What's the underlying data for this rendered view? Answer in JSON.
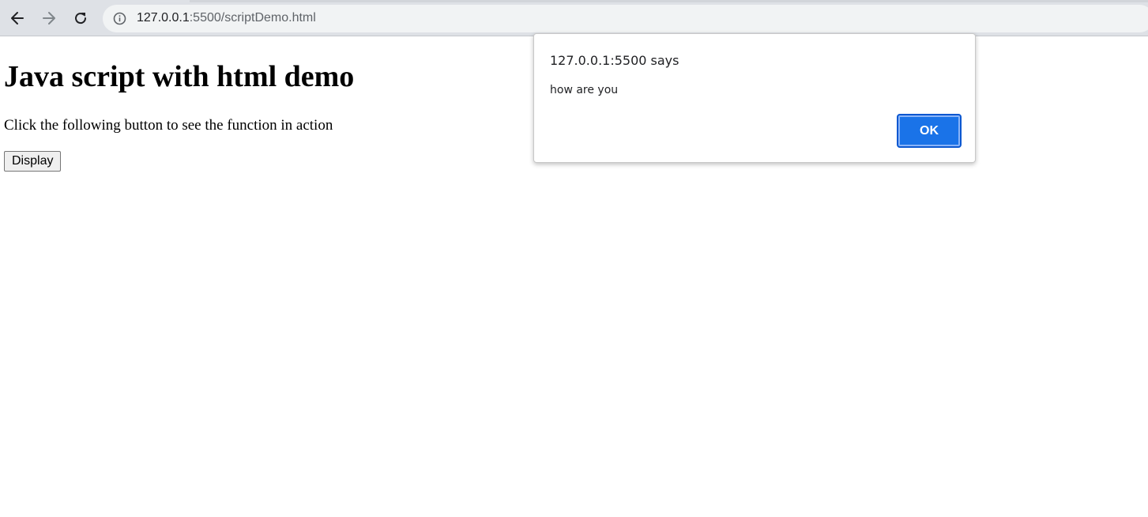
{
  "browser": {
    "url_host": "127.0.0.1",
    "url_rest": ":5500/scriptDemo.html",
    "icons": {
      "back": "arrow-left-icon",
      "forward": "arrow-right-icon",
      "reload": "reload-icon",
      "site_info": "info-icon"
    }
  },
  "page": {
    "title": "Java script with html demo",
    "paragraph": "Click the following button to see the function in action",
    "button_label": "Display"
  },
  "alert": {
    "origin": "127.0.0.1:5500 says",
    "message": "how are you",
    "ok_label": "OK",
    "accent_color": "#1a73e8"
  }
}
